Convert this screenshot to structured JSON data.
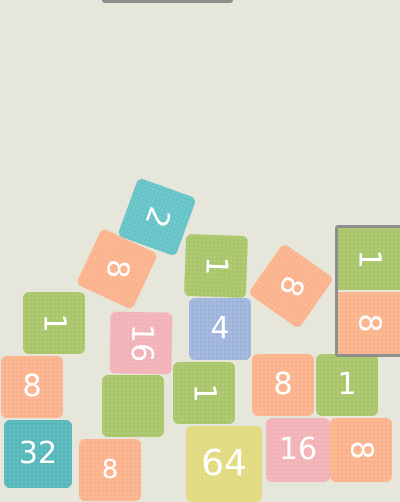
{
  "colors": {
    "background": "#e7e6da",
    "tile_1": "#a9c66a",
    "tile_2": "#66c3c7",
    "tile_4": "#9fb5dc",
    "tile_8": "#fbb38d",
    "tile_16": "#f2b2b7",
    "tile_32": "#56b8bb",
    "tile_64": "#e1da80",
    "holder_border": "#8f8f8f"
  },
  "tiles": {
    "t01": "2",
    "t02": "8",
    "t03": "1",
    "t04": "8",
    "t05": "1",
    "t06": "16",
    "t07": "4",
    "t08": "8",
    "t09": "",
    "t10": "1",
    "t11": "8",
    "t12": "1",
    "t13": "32",
    "t14": "8",
    "t15": "64",
    "t16": "16",
    "t17": "8"
  },
  "next_pair": {
    "top": "1",
    "bottom": "8"
  }
}
